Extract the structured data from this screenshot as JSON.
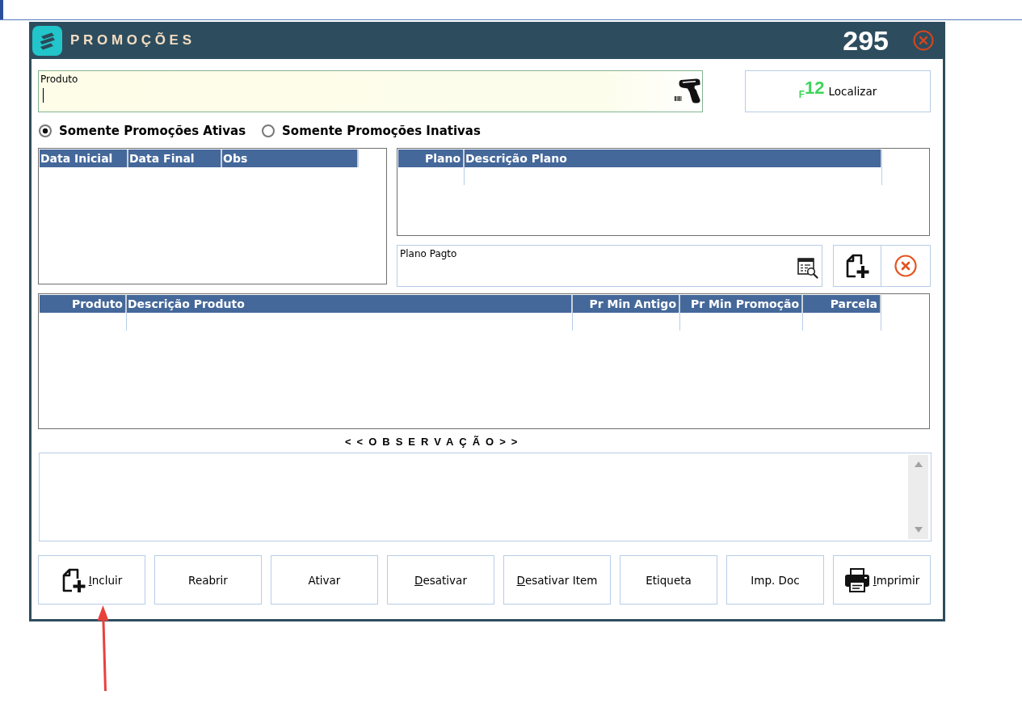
{
  "window": {
    "title": "PROMOÇÕES",
    "record_number": "295"
  },
  "product_field": {
    "label": "Produto"
  },
  "find_button": {
    "shortcut": "$_{F}$12",
    "label": "Localizar"
  },
  "filters": [
    {
      "label": "Somente Promoções Ativas",
      "selected": true
    },
    {
      "label": "Somente Promoções Inativas",
      "selected": false
    }
  ],
  "periods_table": {
    "columns": [
      {
        "label": "Data Inicial",
        "kind": "text"
      },
      {
        "label": "Data Final",
        "kind": "text"
      },
      {
        "label": "Obs",
        "kind": "text"
      }
    ]
  },
  "plans_table": {
    "columns": [
      {
        "label": "Plano",
        "kind": "numeric"
      },
      {
        "label": "Descrição Plano",
        "kind": "text"
      }
    ]
  },
  "payment_plan_field": {
    "label": "Plano Pagto"
  },
  "products_table": {
    "columns": [
      {
        "label": "Produto",
        "kind": "numeric"
      },
      {
        "label": "Descrição Produto",
        "kind": "text"
      },
      {
        "label": "Pr Min Antigo",
        "kind": "numeric"
      },
      {
        "label": "Pr Min Promoção",
        "kind": "numeric"
      },
      {
        "label": "Parcela",
        "kind": "numeric"
      }
    ]
  },
  "observation": {
    "title": "<<OBSERVAÇÃO>>"
  },
  "buttons": [
    {
      "label": "Incluir",
      "kind": "add",
      "mnemonic": true
    },
    {
      "label": "Reabrir",
      "kind": "plain",
      "mnemonic": false
    },
    {
      "label": "Ativar",
      "kind": "plain",
      "mnemonic": false
    },
    {
      "label": "Desativar",
      "kind": "plain",
      "mnemonic": true
    },
    {
      "label": "Desativar Item",
      "kind": "plain",
      "mnemonic": true
    },
    {
      "label": "Etiqueta",
      "kind": "plain",
      "mnemonic": false
    },
    {
      "label": "Imp. Doc",
      "kind": "plain",
      "mnemonic": false
    },
    {
      "label": "Imprimir",
      "kind": "print",
      "mnemonic": true
    }
  ]
}
